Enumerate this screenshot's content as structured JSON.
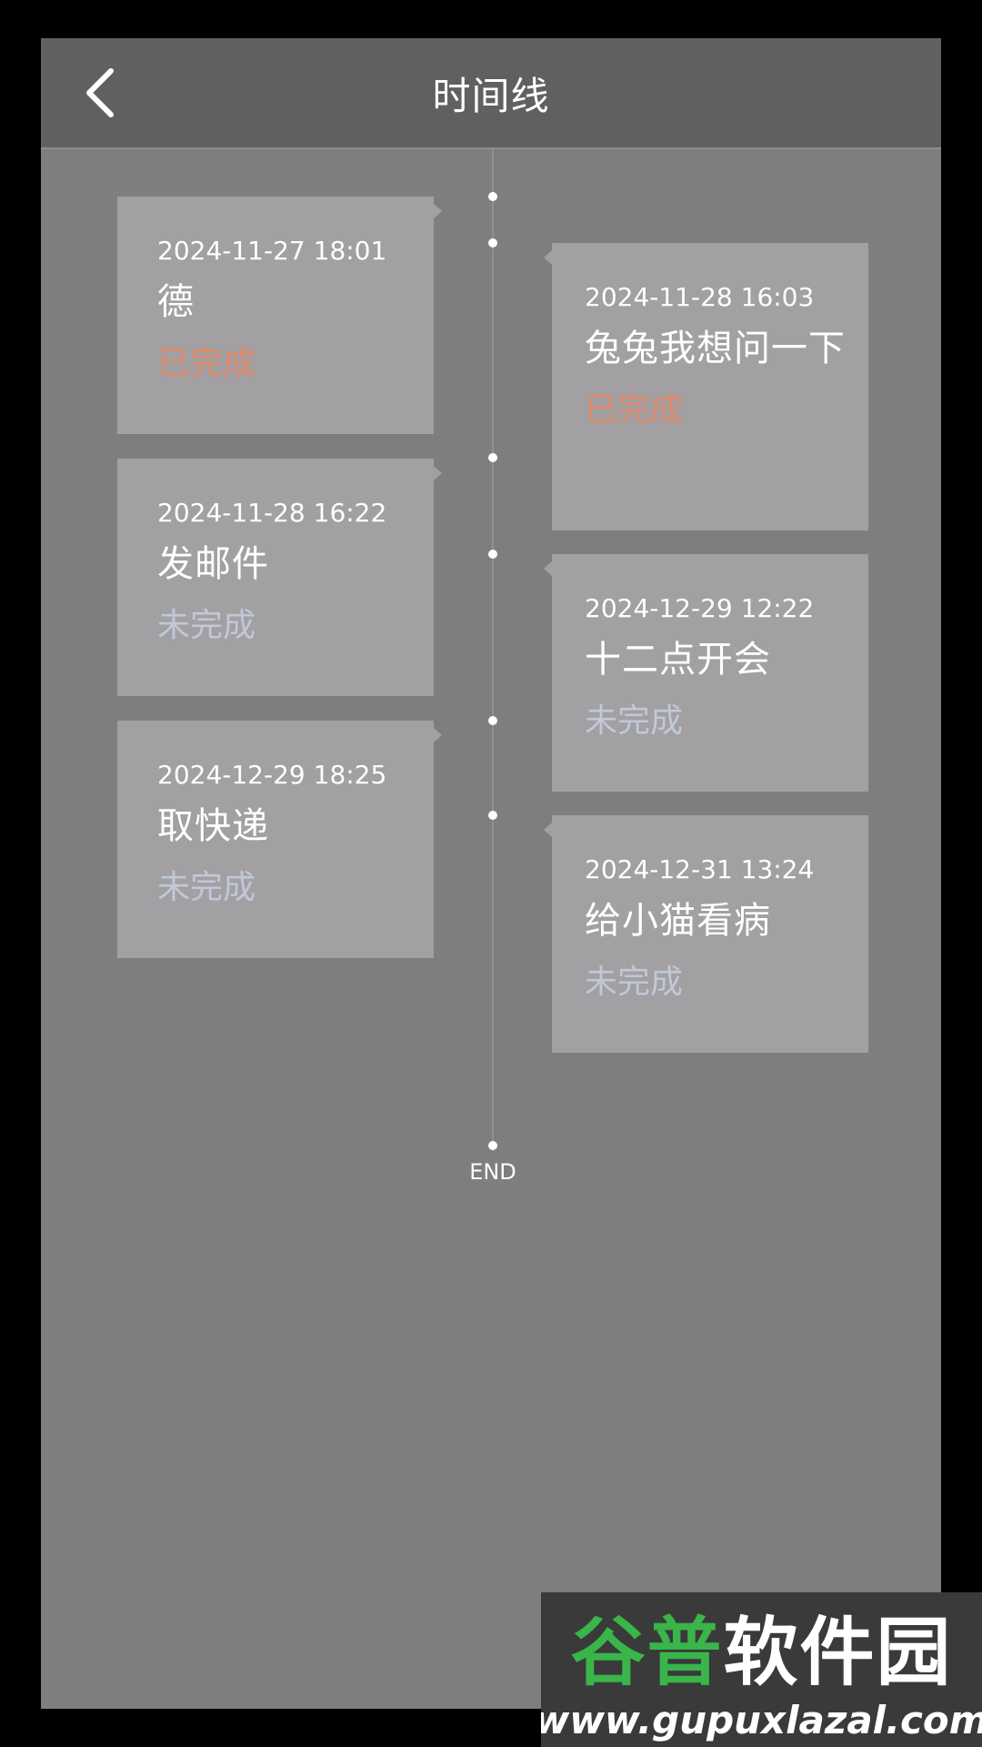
{
  "header": {
    "title": "时间线"
  },
  "timeline": {
    "end_label": "END",
    "items": [
      {
        "date": "2024-11-27 18:01",
        "name": "德",
        "status": "已完成"
      },
      {
        "date": "2024-11-28 16:03",
        "name": "兔兔我想问一下",
        "status": "已完成"
      },
      {
        "date": "2024-11-28 16:22",
        "name": "发邮件",
        "status": "未完成"
      },
      {
        "date": "2024-12-29 12:22",
        "name": "十二点开会",
        "status": "未完成"
      },
      {
        "date": "2024-12-29 18:25",
        "name": "取快递",
        "status": "未完成"
      },
      {
        "date": "2024-12-31 13:24",
        "name": "给小猫看病",
        "status": "未完成"
      }
    ]
  },
  "watermark": {
    "brand": "谷普软件园",
    "url": "www.gupuxlazal.com"
  },
  "colors": {
    "done": "#e08a6c",
    "todo": "#c1c8d8",
    "card": "#a2a0a2",
    "background": "#7e7e7e",
    "header": "#606060"
  },
  "icons": {
    "back": "chevron-left-icon"
  }
}
